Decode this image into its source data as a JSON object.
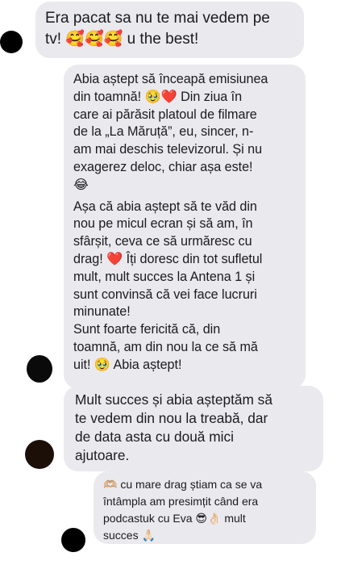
{
  "messages": [
    {
      "lines": [
        "Era pacat sa nu te mai vedem pe",
        "tv! 🥰🥰🥰 u the best!"
      ]
    },
    {
      "paragraphs": [
        [
          "Abia aștept să înceapă emisiunea",
          "din toamnă! 🥹❤️ Din ziua în",
          "care ai părăsit platoul de filmare",
          "de la „La Măruță”, eu, sincer, n-",
          "am mai deschis televizorul. Și nu",
          "exagerez deloc, chiar așa este!",
          "😂"
        ],
        [
          "Așa că abia aștept să te văd din",
          "nou pe micul ecran și să am, în",
          "sfârșit, ceva ce să urmăresc cu",
          "drag! ❤️ Îți doresc din tot sufletul",
          "mult, mult succes la Antena 1 și",
          "sunt convinsă că vei face lucruri",
          "minunate!",
          "Sunt foarte fericită că, din",
          "toamnă, am din nou la ce să mă",
          "uit! 🥹 Abia aștept!"
        ]
      ]
    },
    {
      "lines": [
        "Mult succes și abia așteptăm să",
        "te vedem din nou la treabă, dar",
        "de data asta cu două mici",
        "ajutoare."
      ]
    },
    {
      "lines": [
        "🫶🏼 cu mare drag știam ca se va",
        "întâmpla  am presimțit când era",
        "podcastuk cu Eva 😎👌🏻 mult",
        "succes 🙏🏻"
      ]
    }
  ]
}
